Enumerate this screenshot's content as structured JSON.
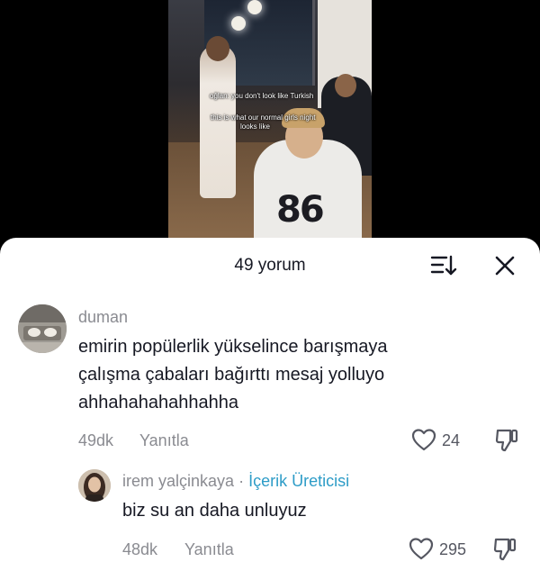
{
  "video": {
    "captions": [
      "oğlan: you don't look like Turkish",
      "this is what our normal girls night",
      "looks like"
    ],
    "jersey_number": "86"
  },
  "sheet": {
    "title": "49 yorum",
    "sort_icon": "sort-icon",
    "close_icon": "close-icon"
  },
  "comments": [
    {
      "username": "duman",
      "text_lines": [
        "emirin popülerlik yükselince barışmaya",
        "çalışma çabaları bağırttı mesaj yolluyo",
        "ahhahahahahhahha"
      ],
      "time": "49dk",
      "reply_label": "Yanıtla",
      "likes": "24"
    },
    {
      "username": "irem yalçinkaya",
      "separator": "·",
      "badge": "İçerik Üreticisi",
      "text_lines": [
        "biz su an daha unluyuz"
      ],
      "time": "48dk",
      "reply_label": "Yanıtla",
      "likes": "295"
    }
  ],
  "colors": {
    "creator_badge": "#2d9cc7",
    "muted_text": "#8a8b91",
    "primary_text": "#161823"
  }
}
